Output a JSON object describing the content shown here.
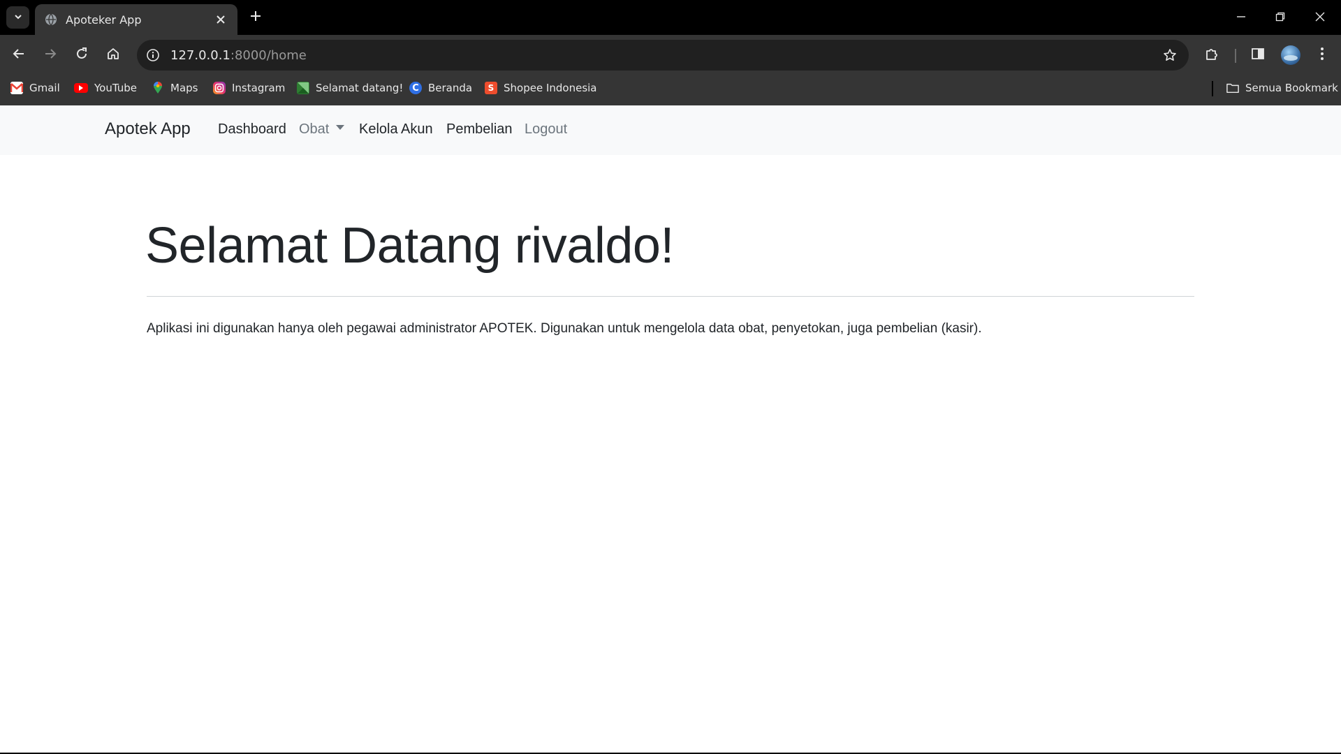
{
  "browser": {
    "tab": {
      "title": "Apoteker App"
    },
    "address": {
      "host": "127.0.0.1",
      "path": ":8000/home"
    },
    "bookmarks": [
      {
        "label": "Gmail",
        "icon": "gmail-icon",
        "color": "#ea4335"
      },
      {
        "label": "YouTube",
        "icon": "youtube-icon",
        "color": "#ff0000"
      },
      {
        "label": "Maps",
        "icon": "maps-icon",
        "color": "#34a853"
      },
      {
        "label": "Instagram",
        "icon": "instagram-icon",
        "color": "#d6249f"
      },
      {
        "label": "Selamat datang!",
        "icon": "flag-icon",
        "color": "#2e7d32"
      },
      {
        "label": "Beranda",
        "icon": "c-logo-icon",
        "color": "#2f6fe4"
      },
      {
        "label": "Shopee Indonesia",
        "icon": "shopee-icon",
        "color": "#ee4d2d"
      }
    ],
    "all_bookmarks_label": "Semua Bookmark"
  },
  "navbar": {
    "brand": "Apotek App",
    "links": [
      "Dashboard",
      "Obat",
      "Kelola Akun",
      "Pembelian",
      "Logout"
    ]
  },
  "main": {
    "title": "Selamat Datang rivaldo!",
    "description": "Aplikasi ini digunakan hanya oleh pegawai administrator APOTEK. Digunakan untuk mengelola data obat, penyetokan, juga pembelian (kasir)."
  }
}
